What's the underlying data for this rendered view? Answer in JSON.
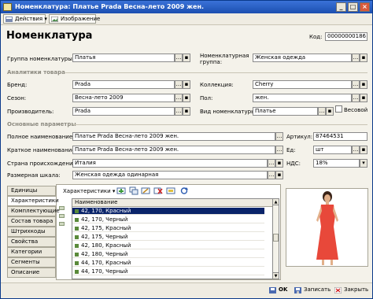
{
  "window": {
    "title": "Номенклатура: Платье Prada Весна-лето 2009 жен."
  },
  "toolbar": {
    "actions_label": "Действия",
    "image_label": "Изображение"
  },
  "header": {
    "page_title": "Номенклатура",
    "code_label": "Код:",
    "code_value": "00000000186"
  },
  "group": {
    "label": "Группа номенклатуры:",
    "value": "Платья"
  },
  "nom_group": {
    "label": "Номенклатурная\nгруппа:",
    "value": "Женская одежда"
  },
  "analytics": {
    "section_label": "Аналитики товара",
    "brand_label": "Бренд:",
    "brand_value": "Prada",
    "season_label": "Сезон:",
    "season_value": "Весна-лето 2009",
    "maker_label": "Производитель:",
    "maker_value": "Prada",
    "collection_label": "Коллекция:",
    "collection_value": "Cherry",
    "sex_label": "Пол:",
    "sex_value": "жен.",
    "kind_label": "Вид номенклатуры:",
    "kind_value": "Платье",
    "weight_label": "Весовой"
  },
  "params": {
    "section_label": "Основные параметры",
    "full_name_label": "Полное наименование:",
    "full_name_value": "Платье Prada Весна-лето 2009 жен.",
    "article_label": "Артикул:",
    "article_value": "87464531",
    "short_name_label": "Краткое наименование:",
    "short_name_value": "Платье Prada Весна-лето 2009 жен.",
    "unit_label": "Ед:",
    "unit_value": "шт",
    "country_label": "Страна происхождения:",
    "country_value": "Италия",
    "vat_label": "НДС:",
    "vat_value": "18%",
    "scale_label": "Размерная шкала:",
    "scale_value": "Женская одежда одинарная"
  },
  "tabs": [
    "Единицы",
    "Характеристики",
    "Комплектующие",
    "Состав товара",
    "Штрихкоды",
    "Свойства",
    "Категории",
    "Сегменты",
    "Описание"
  ],
  "grid": {
    "menu_label": "Характеристики",
    "column_header": "Наименование",
    "rows": [
      "42, 170, Красный",
      "42, 170, Черный",
      "42, 175, Красный",
      "42, 175, Черный",
      "42, 180, Красный",
      "42, 180, Черный",
      "44, 170, Красный",
      "44, 170, Черный"
    ]
  },
  "footer": {
    "ok_label": "OK",
    "save_label": "Записать",
    "close_label": "Закрыть"
  },
  "colors": {
    "titlebar": "#1c4fb0",
    "selection": "#0a246a",
    "dress": "#e8483a"
  }
}
